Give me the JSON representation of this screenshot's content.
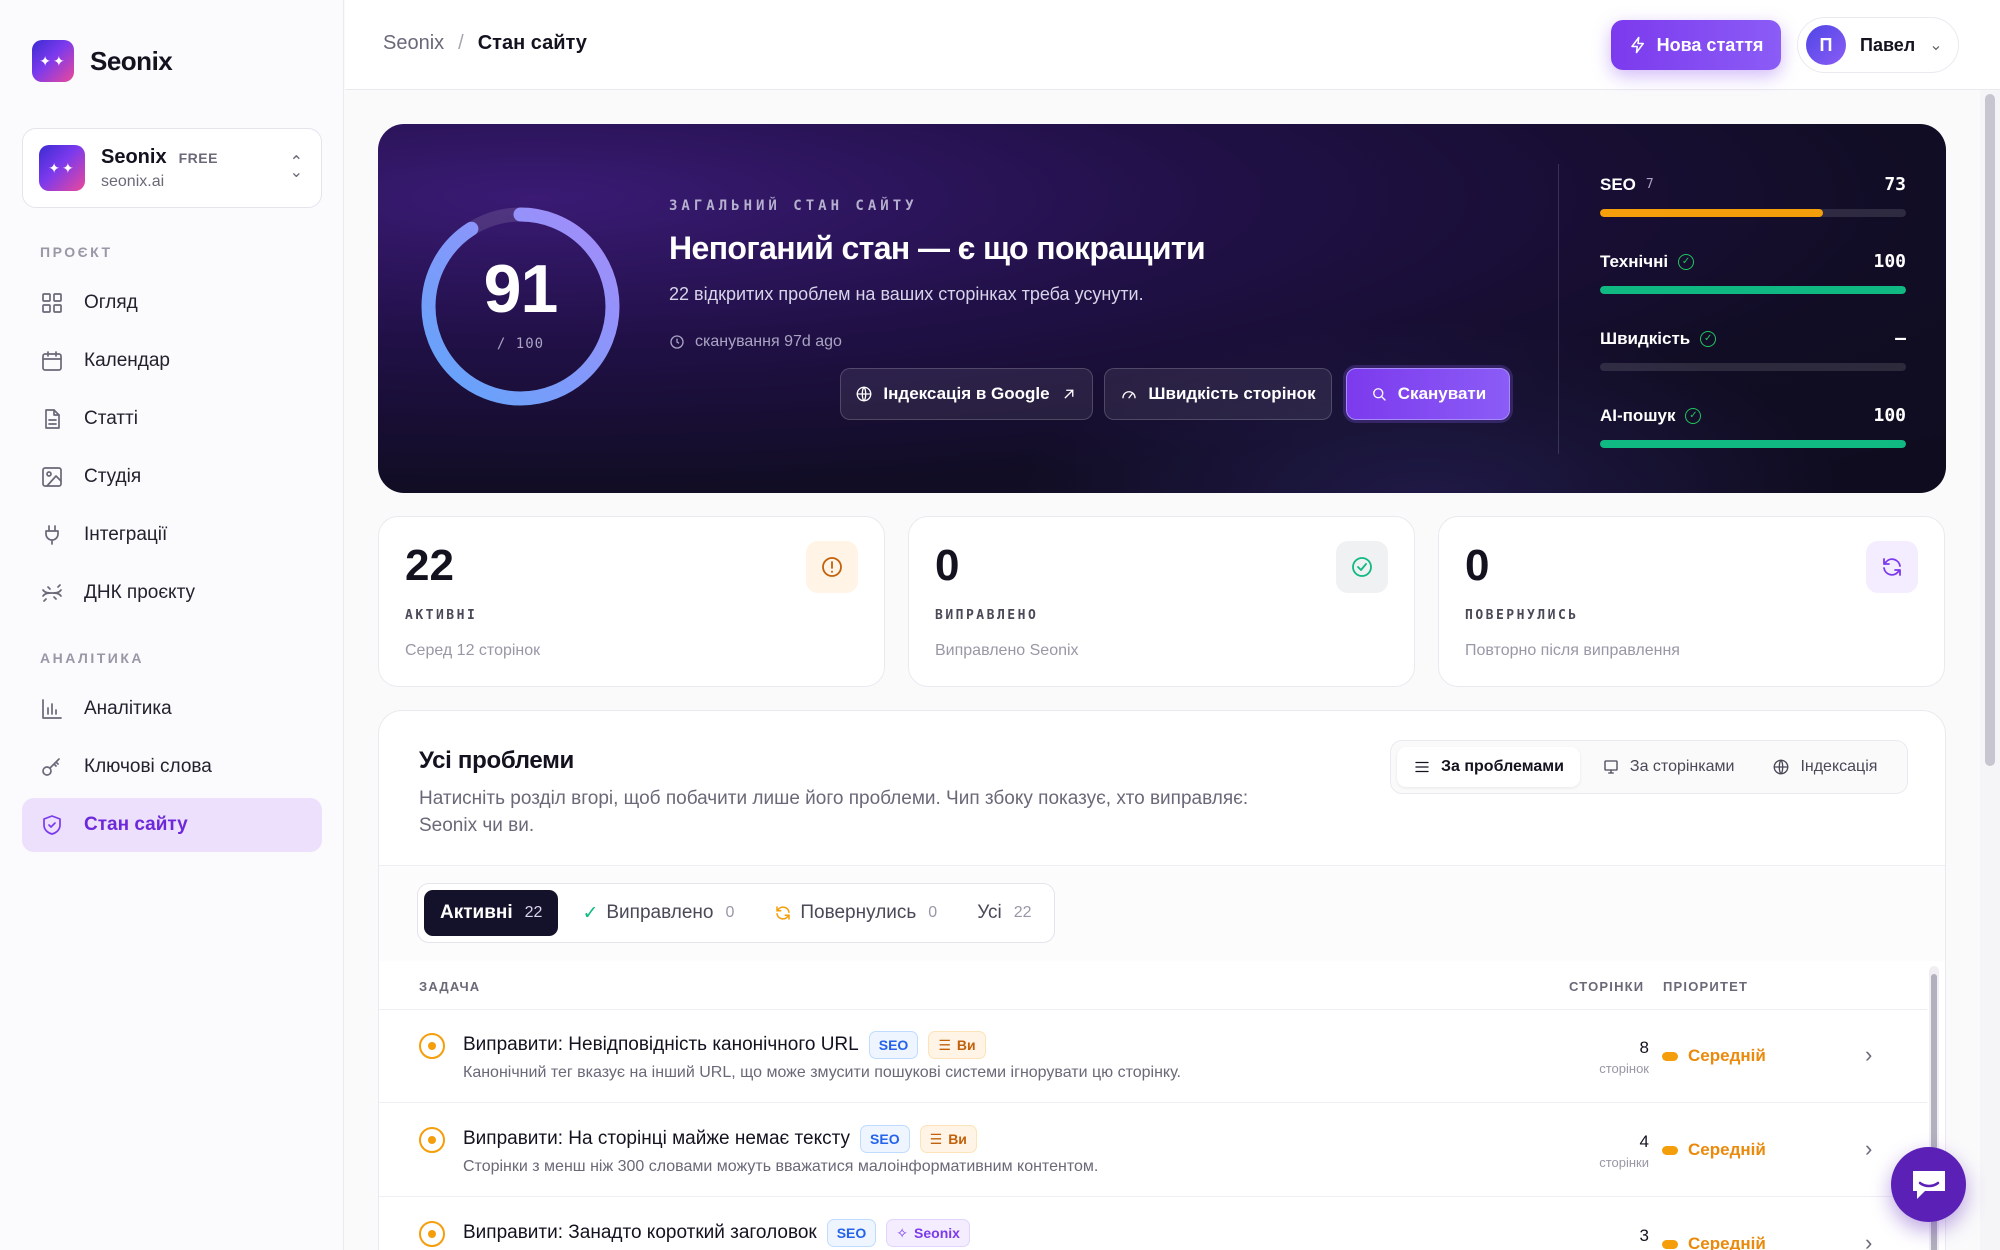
{
  "app": {
    "name": "Seonix"
  },
  "workspace": {
    "name": "Seonix",
    "plan": "FREE",
    "url": "seonix.ai"
  },
  "nav": {
    "section_project": "ПРОЄКТ",
    "section_analytics": "АНАЛІТИКА",
    "items": [
      {
        "label": "Огляд",
        "icon": "grid-icon"
      },
      {
        "label": "Календар",
        "icon": "calendar-icon"
      },
      {
        "label": "Статті",
        "icon": "document-icon"
      },
      {
        "label": "Студія",
        "icon": "image-icon"
      },
      {
        "label": "Інтеграції",
        "icon": "plug-icon"
      },
      {
        "label": "ДНК проєкту",
        "icon": "dna-icon"
      },
      {
        "label": "Аналітика",
        "icon": "bar-chart-icon"
      },
      {
        "label": "Ключові слова",
        "icon": "key-icon"
      },
      {
        "label": "Стан сайту",
        "icon": "shield-icon",
        "active": true
      }
    ]
  },
  "header": {
    "breadcrumb_root": "Seonix",
    "breadcrumb_sep": "/",
    "breadcrumb_current": "Стан сайту",
    "new_article": "Нова стаття",
    "user_initial": "П",
    "user_name": "Павел"
  },
  "hero": {
    "score": 91,
    "score_max": "/ 100",
    "label": "ЗАГАЛЬНИЙ СТАН САЙТУ",
    "title": "Непоганий стан — є що покращити",
    "subtitle": "22 відкритих проблем на ваших сторінках треба усунути.",
    "scan_time": "сканування 97d ago",
    "btn_google": "Індексація в Google",
    "btn_speed": "Швидкість сторінок",
    "btn_scan": "Сканувати",
    "metrics": [
      {
        "name": "SEO",
        "count": "7",
        "value": "73",
        "fill": 0.73,
        "color": "#f59e0b"
      },
      {
        "name": "Технічні",
        "ok": true,
        "value": "100",
        "fill": 1.0,
        "color": "#10b981"
      },
      {
        "name": "Швидкість",
        "ok": true,
        "value": "—",
        "fill": 0,
        "color": "#10b981"
      },
      {
        "name": "AI-пошук",
        "ok": true,
        "value": "100",
        "fill": 1.0,
        "color": "#10b981"
      }
    ]
  },
  "stats": [
    {
      "value": "22",
      "label": "АКТИВНІ",
      "desc": "Серед 12 сторінок",
      "icon": "alert-circle-icon",
      "color": "#c2610c",
      "bg": "#fff4e5"
    },
    {
      "value": "0",
      "label": "ВИПРАВЛЕНО",
      "desc": "Виправлено Seonix",
      "icon": "check-circle-icon",
      "color": "#10b981",
      "bg": "#eff1f2"
    },
    {
      "value": "0",
      "label": "ПОВЕРНУЛИСЬ",
      "desc": "Повторно після виправлення",
      "icon": "refresh-icon",
      "color": "#7c3aed",
      "bg": "#f3edff"
    }
  ],
  "problems": {
    "title": "Усі проблеми",
    "subtitle": "Натисніть розділ вгорі, щоб побачити лише його проблеми. Чип збоку показує, хто виправляє: Seonix чи ви.",
    "view_tabs": [
      "За проблемами",
      "За сторінками",
      "Індексація"
    ],
    "filters": [
      {
        "label": "Активні",
        "count": "22"
      },
      {
        "label": "Виправлено",
        "count": "0"
      },
      {
        "label": "Повернулись",
        "count": "0"
      },
      {
        "label": "Усі",
        "count": "22"
      }
    ],
    "col_task": "ЗАДАЧА",
    "col_pages": "СТОРІНКИ",
    "col_priority": "ПРІОРИТЕТ",
    "rows": [
      {
        "title": "Виправити: Невідповідність канонічного URL",
        "tag": "SEO",
        "owner": "Ви",
        "desc": "Канонічний тег вказує на інший URL, що може змусити пошукові системи ігнорувати цю сторінку.",
        "pages": "8",
        "pages_unit": "сторінок",
        "priority": "Середній"
      },
      {
        "title": "Виправити: На сторінці майже немає тексту",
        "tag": "SEO",
        "owner": "Ви",
        "desc": "Сторінки з менш ніж 300 словами можуть вважатися малоінформативним контентом.",
        "pages": "4",
        "pages_unit": "сторінки",
        "priority": "Середній"
      },
      {
        "title": "Виправити: Занадто короткий заголовок",
        "tag": "SEO",
        "owner": "Seonix",
        "desc": "",
        "pages": "3",
        "pages_unit": "",
        "priority": "Середній"
      }
    ]
  }
}
